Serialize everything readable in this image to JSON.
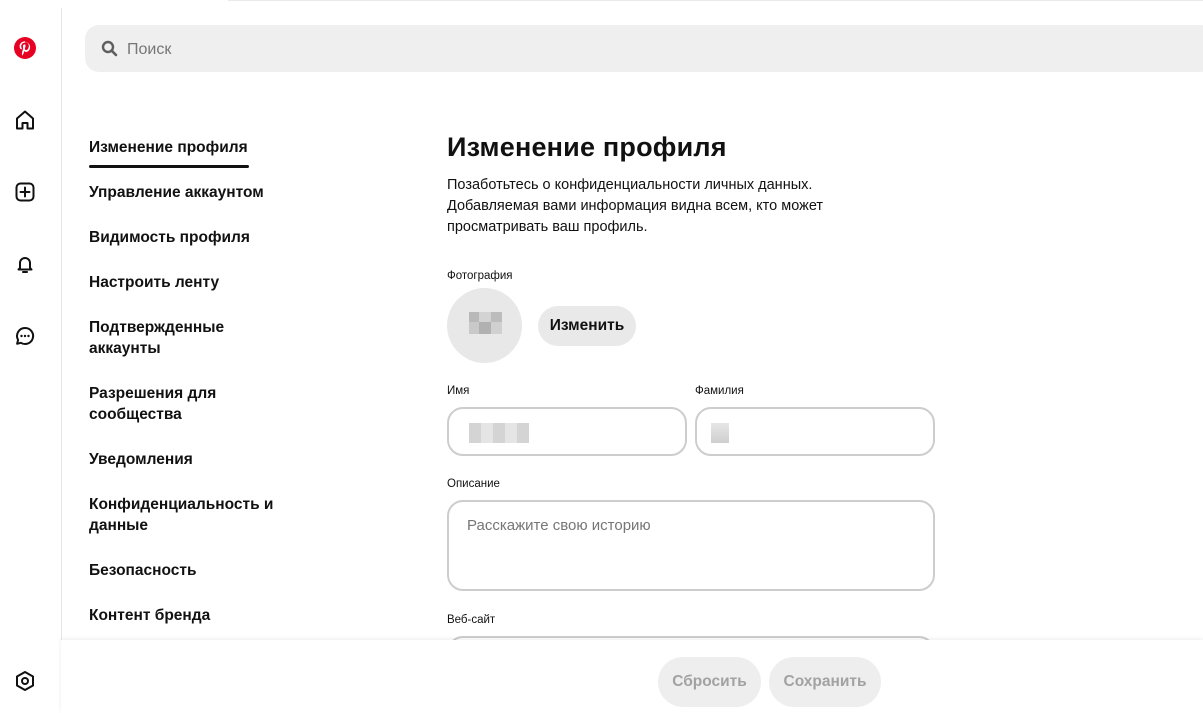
{
  "search": {
    "placeholder": "Поиск"
  },
  "rail": {
    "brand_color": "#e60023",
    "icons": [
      "pinterest-logo-icon",
      "home-icon",
      "create-plus-icon",
      "bell-icon",
      "chat-bubble-icon",
      "settings-hexagon-icon"
    ]
  },
  "settings_nav": {
    "items": [
      {
        "label": "Изменение профиля",
        "active": true
      },
      {
        "label": "Управление аккаунтом"
      },
      {
        "label": "Видимость профиля"
      },
      {
        "label": "Настроить ленту"
      },
      {
        "label": "Подтвержденные аккаунты"
      },
      {
        "label": "Разрешения для сообщества"
      },
      {
        "label": "Уведомления"
      },
      {
        "label": "Конфиденциальность и данные"
      },
      {
        "label": "Безопасность"
      },
      {
        "label": "Контент бренда"
      }
    ]
  },
  "main": {
    "title": "Изменение профиля",
    "subtitle": "Позаботьтесь о конфиденциальности личных данных. Добавляемая вами информация видна всем, кто может просматривать ваш профиль.",
    "photo": {
      "label": "Фотография",
      "change_button": "Изменить"
    },
    "first_name": {
      "label": "Имя",
      "value": ""
    },
    "last_name": {
      "label": "Фамилия",
      "value": ""
    },
    "description": {
      "label": "Описание",
      "placeholder": "Расскажите свою историю"
    },
    "website": {
      "label": "Веб-сайт"
    }
  },
  "footer": {
    "reset_label": "Сбросить",
    "save_label": "Сохранить"
  }
}
